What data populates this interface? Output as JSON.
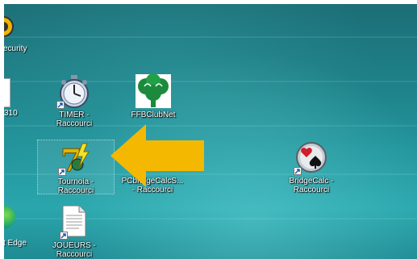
{
  "desktop": {
    "partial_labels": {
      "security": "ecurity",
      "left_num": "310",
      "edge": "t Edge"
    },
    "icons": [
      {
        "name": "TIMER",
        "label": "TIMER -\nRaccourci",
        "icon": "stopwatch-icon"
      },
      {
        "name": "FFBClubNet",
        "label": "FFBClubNet",
        "icon": "tree-icon"
      },
      {
        "name": "Tournoia",
        "label": "Tournoia -\nRaccourci",
        "icon": "seven-bolt-icon",
        "selected": true
      },
      {
        "name": "PCbridgeCalc",
        "label": "PCbridgeCalcS...\n- Raccourci",
        "icon": "program-icon"
      },
      {
        "name": "BridgeCalc",
        "label": "BridgeCalc -\nRaccourci",
        "icon": "cards-icon"
      },
      {
        "name": "JOUEURS",
        "label": "JOUEURS -\nRaccourci",
        "icon": "document-icon"
      }
    ],
    "annotation": {
      "type": "arrow",
      "color": "#f5b800",
      "direction": "left"
    }
  }
}
